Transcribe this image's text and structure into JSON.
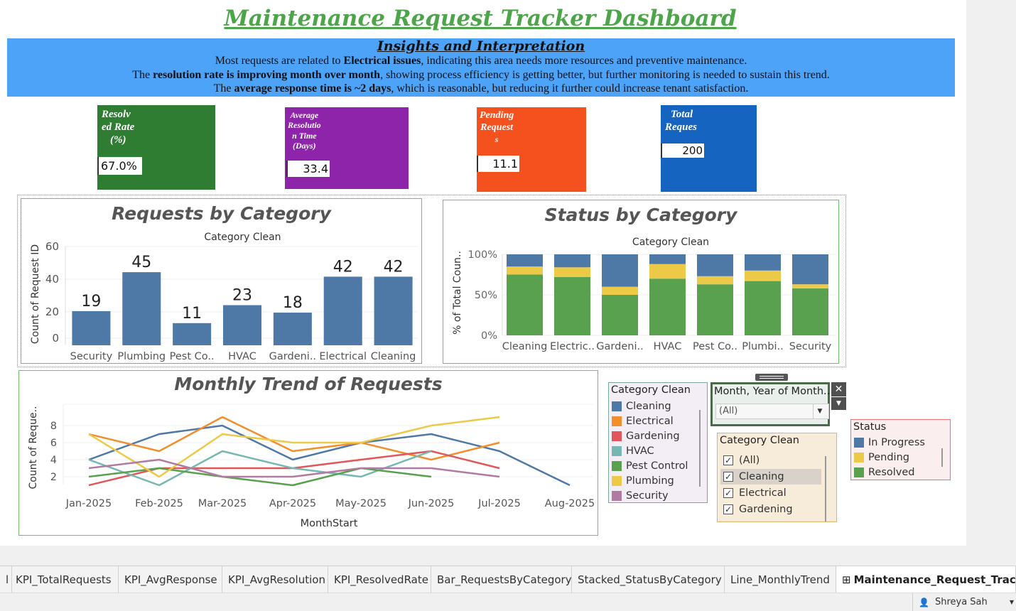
{
  "title": "Maintenance Request Tracker Dashboard",
  "insights": {
    "heading": "Insights and Interpretation",
    "line1_pre": "Most requests are related to ",
    "line1_bold": "Electrical issues",
    "line1_post": ", indicating this area needs more resources and preventive maintenance.",
    "line2_pre": "The ",
    "line2_bold": "resolution rate is improving month over month",
    "line2_post": ", showing process efficiency is getting better, but further monitoring is needed to sustain this trend.",
    "line3_pre": "The ",
    "line3_bold": "average response time is ~2 days",
    "line3_post": ", which is reasonable, but reducing it further could increase tenant satisfaction."
  },
  "kpis": {
    "resolved": {
      "l1": "Resolv",
      "l2": "ed Rate",
      "l3": "(%)",
      "value": "67.0%",
      "color": "#2e7d32"
    },
    "avg_resolution": {
      "l1": "Average",
      "l2": "Resolutio",
      "l3": "n Time",
      "l4": "(Days)",
      "value": "33.4",
      "color": "#8e24aa"
    },
    "pending": {
      "l1": "Pending",
      "l2": "Request",
      "l3": "s",
      "value": "11.1",
      "color": "#f4511e"
    },
    "total": {
      "l1": "Total",
      "l2": "Reques",
      "value": "200",
      "color": "#1565c0"
    }
  },
  "requests_by_category": {
    "title": "Requests by Category",
    "subtitle": "Category Clean",
    "ylabel": "Count of Request ID",
    "ticks": [
      "0",
      "20",
      "40",
      "60"
    ]
  },
  "status_by_category": {
    "title": "Status by Category",
    "subtitle": "Category Clean",
    "ylabel": "% of Total Coun..",
    "ticks": [
      "0%",
      "50%",
      "100%"
    ]
  },
  "monthly_trend": {
    "title": "Monthly Trend of Requests",
    "xlabel": "MonthStart",
    "ylabel": "Count of Reque..",
    "ticks": [
      "2",
      "4",
      "6",
      "8"
    ]
  },
  "chart_data": [
    {
      "type": "bar",
      "title": "Requests by Category",
      "xlabel": "Category Clean",
      "ylabel": "Count of Request ID",
      "categories": [
        "Security",
        "Plumbing",
        "Pest Co..",
        "HVAC",
        "Gardeni..",
        "Electrical",
        "Cleaning"
      ],
      "values": [
        19,
        45,
        11,
        23,
        18,
        42,
        42
      ],
      "ylim": [
        0,
        60
      ],
      "color": "#4e79a7"
    },
    {
      "type": "bar",
      "stacked": true,
      "title": "Status by Category",
      "xlabel": "Category Clean",
      "ylabel": "% of Total Coun..",
      "categories": [
        "Cleaning",
        "Electric..",
        "Gardeni..",
        "HVAC",
        "Pest Co..",
        "Plumbi..",
        "Security"
      ],
      "series": [
        {
          "name": "Resolved",
          "color": "#59a14f",
          "values": [
            75,
            72,
            50,
            70,
            63,
            67,
            58
          ]
        },
        {
          "name": "Pending",
          "color": "#edc948",
          "values": [
            10,
            12,
            10,
            18,
            10,
            13,
            5
          ]
        },
        {
          "name": "In Progress",
          "color": "#4e79a7",
          "values": [
            15,
            16,
            40,
            12,
            27,
            20,
            37
          ]
        }
      ],
      "ylim": [
        0,
        100
      ]
    },
    {
      "type": "line",
      "title": "Monthly Trend of Requests",
      "xlabel": "MonthStart",
      "ylabel": "Count of Reque..",
      "x": [
        "Jan-2025",
        "Feb-2025",
        "Mar-2025",
        "Apr-2025",
        "May-2025",
        "Jun-2025",
        "Jul-2025",
        "Aug-2025"
      ],
      "ylim": [
        0,
        9
      ],
      "series": [
        {
          "name": "Cleaning",
          "color": "#4e79a7",
          "values": [
            4,
            7,
            8,
            4,
            6,
            7,
            5,
            1
          ]
        },
        {
          "name": "Electrical",
          "color": "#f28e2b",
          "values": [
            7,
            5,
            9,
            5,
            6,
            4,
            6,
            null
          ]
        },
        {
          "name": "Gardening",
          "color": "#e15759",
          "values": [
            1,
            3,
            3,
            3,
            4,
            5,
            3,
            null
          ]
        },
        {
          "name": "HVAC",
          "color": "#76b7b2",
          "values": [
            4,
            1,
            5,
            3,
            2,
            5,
            null,
            null
          ]
        },
        {
          "name": "Pest Control",
          "color": "#59a14f",
          "values": [
            2,
            3,
            2,
            1,
            3,
            2,
            null,
            null
          ]
        },
        {
          "name": "Plumbing",
          "color": "#edc948",
          "values": [
            7,
            2,
            7,
            6,
            6,
            8,
            9,
            null
          ]
        },
        {
          "name": "Security",
          "color": "#b07aa1",
          "values": [
            3,
            4,
            2,
            2,
            3,
            3,
            2,
            null
          ]
        }
      ]
    }
  ],
  "legend_category": {
    "title": "Category Clean",
    "items": [
      {
        "label": "Cleaning",
        "color": "#4e79a7"
      },
      {
        "label": "Electrical",
        "color": "#f28e2b"
      },
      {
        "label": "Gardening",
        "color": "#e15759"
      },
      {
        "label": "HVAC",
        "color": "#76b7b2"
      },
      {
        "label": "Pest Control",
        "color": "#59a14f"
      },
      {
        "label": "Plumbing",
        "color": "#edc948"
      },
      {
        "label": "Security",
        "color": "#b07aa1"
      }
    ]
  },
  "month_filter": {
    "title": "Month, Year of Month..",
    "value": "(All)",
    "close": "✕"
  },
  "category_filter": {
    "title": "Category Clean",
    "items": [
      {
        "label": "(All)",
        "checked": true
      },
      {
        "label": "Cleaning",
        "checked": true
      },
      {
        "label": "Electrical",
        "checked": true
      },
      {
        "label": "Gardening",
        "checked": true
      }
    ]
  },
  "legend_status": {
    "title": "Status",
    "items": [
      {
        "label": "In Progress",
        "color": "#4e79a7"
      },
      {
        "label": "Pending",
        "color": "#edc948"
      },
      {
        "label": "Resolved",
        "color": "#59a14f"
      }
    ]
  },
  "tabs": [
    {
      "label": "l"
    },
    {
      "label": "KPI_TotalRequests"
    },
    {
      "label": "KPI_AvgResponse"
    },
    {
      "label": "KPI_AvgResolution"
    },
    {
      "label": "KPI_ResolvedRate"
    },
    {
      "label": "Bar_RequestsByCategory"
    },
    {
      "label": "Stacked_StatusByCategory"
    },
    {
      "label": "Line_MonthlyTrend"
    },
    {
      "label": "Maintenance_Request_Trac..."
    }
  ],
  "status": {
    "user": "Shreya Sah"
  }
}
